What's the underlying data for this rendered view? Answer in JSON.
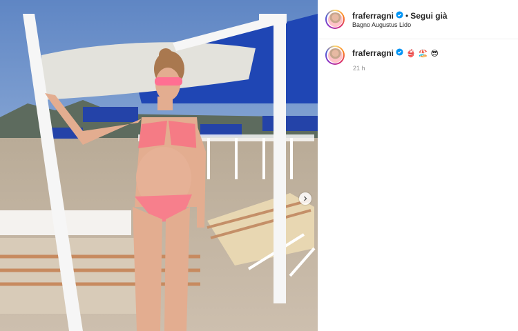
{
  "post": {
    "username": "fraferragni",
    "follow_status": "Segui già",
    "separator": "•",
    "location": "Bagno Augustus Lido",
    "caption_username": "fraferragni",
    "caption_emojis": [
      "👙",
      "🏖️",
      "😎"
    ],
    "time_ago": "21 h"
  },
  "icons": {
    "verified": "verified-badge-icon",
    "carousel": "chevron-right-icon"
  },
  "colors": {
    "verified_blue": "#0095f6",
    "text": "#262626",
    "muted": "#8e8e8e",
    "border": "#efefef"
  }
}
